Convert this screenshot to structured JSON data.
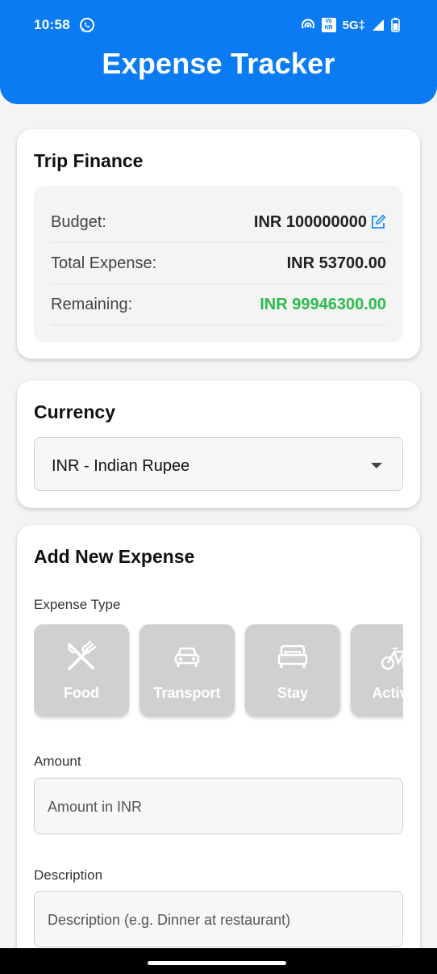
{
  "status_bar": {
    "time": "10:58",
    "volte_top": "Vo",
    "volte_bottom": "NR",
    "network": "5G‡",
    "icons": [
      "whatsapp-icon",
      "hotspot-icon",
      "volte-icon",
      "signal-icon",
      "battery-icon"
    ]
  },
  "app": {
    "title": "Expense Tracker",
    "accent_color": "#0a7bf2",
    "positive_color": "#2dbb4e"
  },
  "trip_finance": {
    "title": "Trip Finance",
    "rows": [
      {
        "label": "Budget:",
        "value": "INR 100000000"
      },
      {
        "label": "Total Expense:",
        "value": "INR 53700.00"
      },
      {
        "label": "Remaining:",
        "value": "INR 99946300.00"
      }
    ]
  },
  "currency": {
    "title": "Currency",
    "selected": "INR - Indian Rupee"
  },
  "add_expense": {
    "title": "Add New Expense",
    "expense_type_label": "Expense Type",
    "types": [
      {
        "label": "Food",
        "icon": "utensils-icon"
      },
      {
        "label": "Transport",
        "icon": "car-icon"
      },
      {
        "label": "Stay",
        "icon": "bed-icon"
      },
      {
        "label": "Activity",
        "icon": "bicycle-icon"
      }
    ],
    "amount_label": "Amount",
    "amount_placeholder": "Amount in INR",
    "description_label": "Description",
    "description_placeholder": "Description (e.g. Dinner at restaurant)"
  }
}
